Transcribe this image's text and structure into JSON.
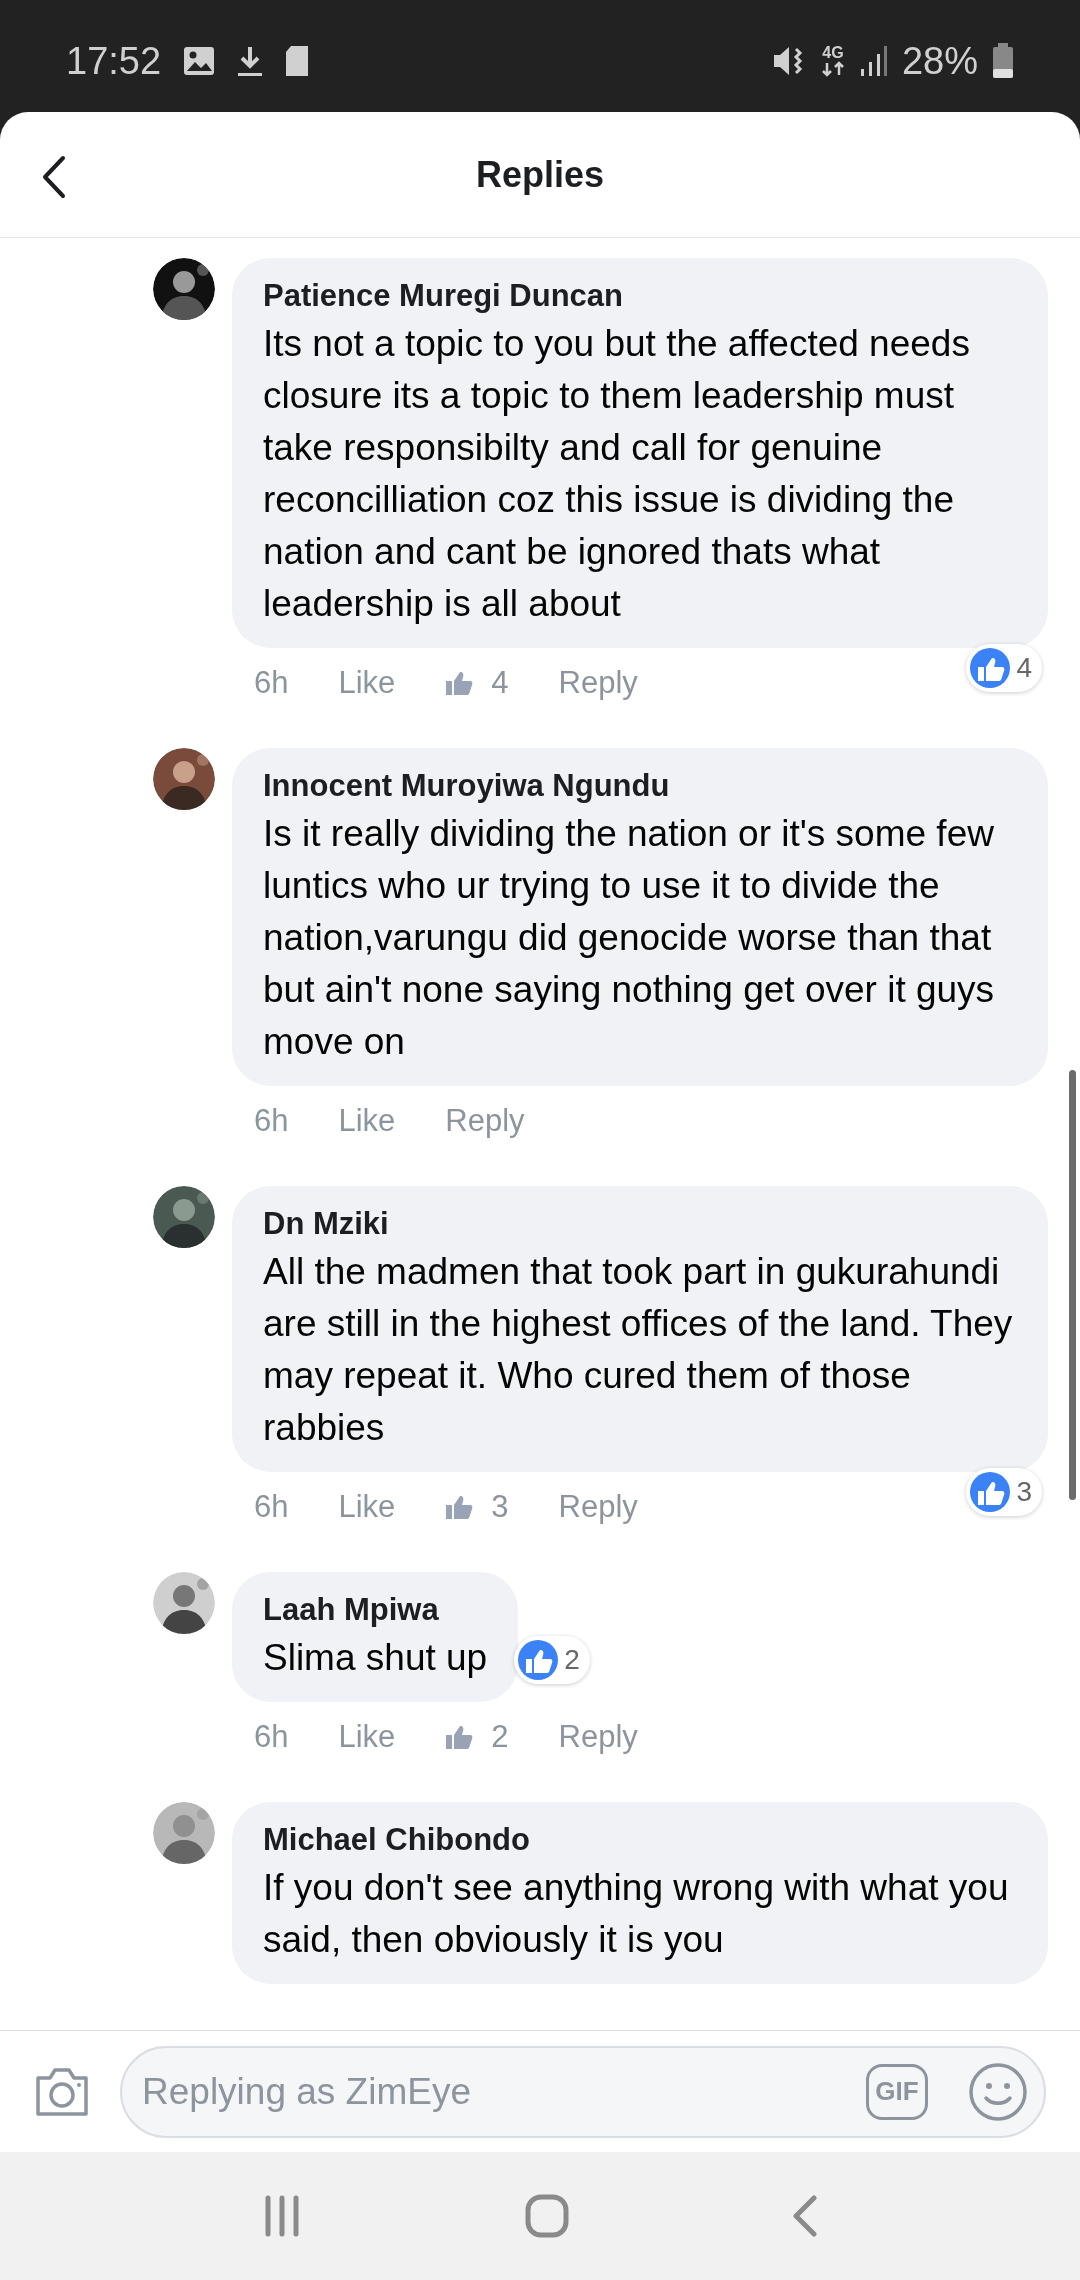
{
  "status_bar": {
    "time": "17:52",
    "network": "4G",
    "battery": "28%"
  },
  "header": {
    "title": "Replies"
  },
  "comments": [
    {
      "author": "Patience Muregi Duncan",
      "text": "Its not a topic to you but the affected needs closure its a topic to them leadership must take responsibilty and call for genuine reconcilliation coz this issue is dividing the nation and cant be ignored thats what leadership is all about",
      "time": "6h",
      "like": "Like",
      "like_count": "4",
      "reply": "Reply",
      "reactions": "4"
    },
    {
      "author": "Innocent Muroyiwa Ngundu",
      "text": "Is it really dividing the nation or it's some few luntics who ur trying to use it to divide the nation,varungu did genocide worse than that but ain't none saying nothing get over it guys move on",
      "time": "6h",
      "like": "Like",
      "reply": "Reply"
    },
    {
      "author": "Dn Mziki",
      "text": "All the madmen that took part in gukurahundi are still in the highest offices of the land. They may repeat it. Who cured them of those rabbies",
      "time": "6h",
      "like": "Like",
      "like_count": "3",
      "reply": "Reply",
      "reactions": "3"
    },
    {
      "author": "Laah Mpiwa",
      "text": "Slima shut up",
      "time": "6h",
      "like": "Like",
      "like_count": "2",
      "reply": "Reply",
      "reactions": "2"
    },
    {
      "author": "Michael Chibondo",
      "text": "If you don't see anything wrong with what you said, then obviously it is you"
    }
  ],
  "composer": {
    "placeholder": "Replying as ZimEye",
    "gif": "GIF"
  }
}
